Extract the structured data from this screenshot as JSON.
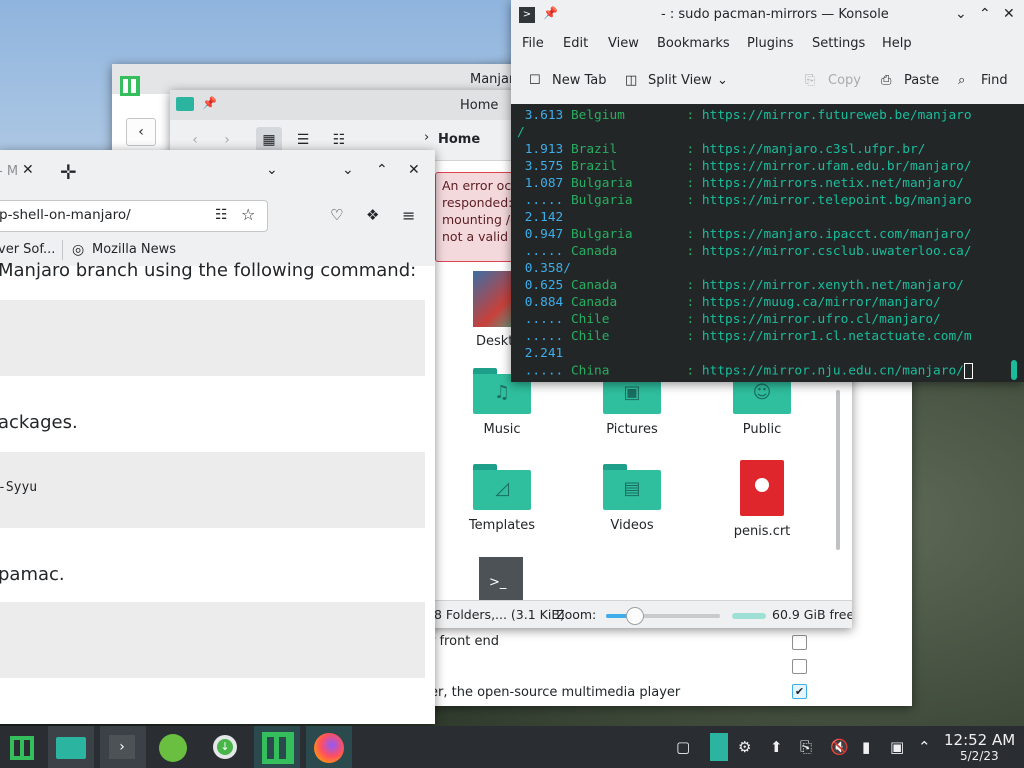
{
  "welcome_window": {
    "title": "Manjaro",
    "back_icon": "chevron-left-icon",
    "packages": [
      {
        "label": "r front end",
        "checked": false
      },
      {
        "label": "",
        "checked": false
      },
      {
        "label": "er, the open-source multimedia player",
        "checked": true
      }
    ]
  },
  "dolphin": {
    "title": "Home — Dolphin",
    "title_visible": "Home",
    "breadcrumb": "Home",
    "error_lines": [
      "An error occ",
      "responded:",
      "mounting /c",
      "not a valid b"
    ],
    "files": [
      {
        "label": "Deskt",
        "icon": "desktop-folder-icon"
      },
      {
        "label": "Music",
        "icon": "music-folder-icon"
      },
      {
        "label": "Pictures",
        "icon": "pictures-folder-icon"
      },
      {
        "label": "Public",
        "icon": "public-folder-icon"
      },
      {
        "label": "Templates",
        "icon": "templates-folder-icon"
      },
      {
        "label": "Videos",
        "icon": "videos-folder-icon"
      },
      {
        "label": "penis.crt",
        "icon": "certificate-file-icon"
      },
      {
        "label": "",
        "icon": "terminal-script-icon"
      }
    ],
    "status": "8 Folders,... (3.1 KiB)",
    "zoom_label": "Zoom:",
    "zoom_level_fraction": 0.2,
    "free_space": "60.9 GiB free"
  },
  "firefox": {
    "tab_title": "- M",
    "url": "p-shell-on-manjaro/",
    "bookmarks": [
      {
        "label": "ver Sof..."
      },
      {
        "label": "Mozilla News"
      }
    ],
    "content": {
      "line1": "Manjaro branch using the following command:",
      "line2": "ackages.",
      "code2": "-Syyu",
      "line3": "pamac."
    }
  },
  "konsole": {
    "title": "- : sudo pacman-mirrors — Konsole",
    "menu": [
      "File",
      "Edit",
      "View",
      "Bookmarks",
      "Plugins",
      "Settings",
      "Help"
    ],
    "toolbar": {
      "new_tab": "New Tab",
      "split_view": "Split View",
      "copy": "Copy",
      "paste": "Paste",
      "find": "Find"
    },
    "lines": [
      {
        "time": "3.613",
        "country": "Belgium",
        "url": "https://mirror.futureweb.be/manjaro"
      },
      {
        "time": "",
        "country": "",
        "url": "/"
      },
      {
        "time": "1.913",
        "country": "Brazil",
        "url": "https://manjaro.c3sl.ufpr.br/"
      },
      {
        "time": "3.575",
        "country": "Brazil",
        "url": "https://mirror.ufam.edu.br/manjaro/"
      },
      {
        "time": "1.087",
        "country": "Bulgaria",
        "url": "https://mirrors.netix.net/manjaro/"
      },
      {
        "time": ".....",
        "country": "Bulgaria",
        "url": "https://mirror.telepoint.bg/manjaro"
      },
      {
        "time": "2.142",
        "country": "",
        "url": ""
      },
      {
        "time": "0.947",
        "country": "Bulgaria",
        "url": "https://manjaro.ipacct.com/manjaro/"
      },
      {
        "time": ".....",
        "country": "Canada",
        "url": "https://mirror.csclub.uwaterloo.ca/"
      },
      {
        "time": "0.358/",
        "country": "",
        "url": ""
      },
      {
        "time": "0.625",
        "country": "Canada",
        "url": "https://mirror.xenyth.net/manjaro/"
      },
      {
        "time": "0.884",
        "country": "Canada",
        "url": "https://muug.ca/mirror/manjaro/"
      },
      {
        "time": ".....",
        "country": "Chile",
        "url": "https://mirror.ufro.cl/manjaro/"
      },
      {
        "time": ".....",
        "country": "Chile",
        "url": "https://mirror1.cl.netactuate.com/m"
      },
      {
        "time": "2.241",
        "country": "",
        "url": ""
      },
      {
        "time": ".....",
        "country": "China",
        "url": "https://mirror.nju.edu.cn/manjaro/"
      }
    ]
  },
  "taskbar": {
    "apps": [
      {
        "name": "manjaro-menu-icon"
      },
      {
        "name": "dolphin-task-icon"
      },
      {
        "name": "konsole-task-icon"
      },
      {
        "name": "mintstick-task-icon"
      },
      {
        "name": "downloader-task-icon"
      },
      {
        "name": "manjaro-hello-task-icon"
      },
      {
        "name": "firefox-task-icon"
      }
    ],
    "clock_time": "12:52 AM",
    "clock_date": "5/2/23"
  },
  "colors": {
    "accent": "#3daee9",
    "manjaro_green": "#35bf5c",
    "folder_teal": "#2fbf9e",
    "terminal_bg": "#232627",
    "taskbar_bg": "#2a2e32"
  }
}
